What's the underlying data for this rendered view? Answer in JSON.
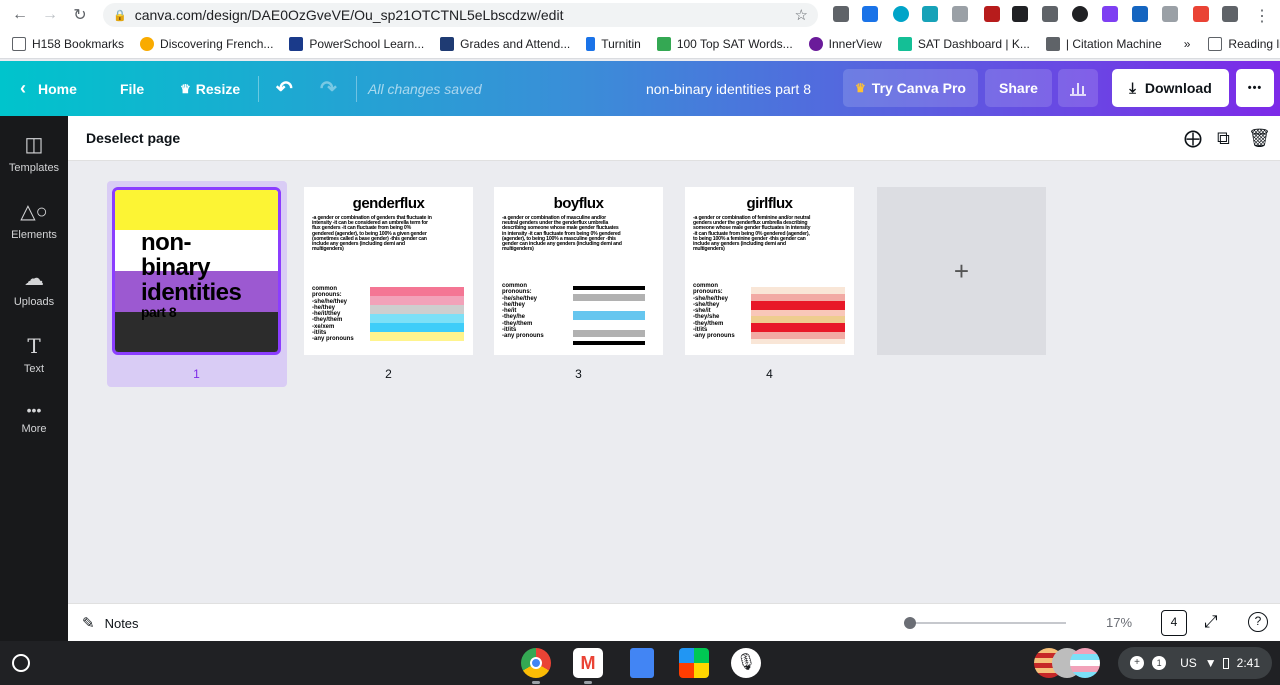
{
  "browser": {
    "url": "canva.com/design/DAE0OzGveVE/Ou_sp21OTCTNL5eLbscdzw/edit",
    "bookmarks": [
      {
        "label": "H158 Bookmarks",
        "color": "#5f6368"
      },
      {
        "label": "Discovering French...",
        "color": "#f9ab00"
      },
      {
        "label": "PowerSchool Learn...",
        "color": "#1a3a8a"
      },
      {
        "label": "Grades and Attend...",
        "color": "#1f3b73"
      },
      {
        "label": "Turnitin",
        "color": "#1a73e8"
      },
      {
        "label": "100 Top SAT Words...",
        "color": "#34a853"
      },
      {
        "label": "InnerView",
        "color": "#6a1b9a"
      },
      {
        "label": "SAT Dashboard | K...",
        "color": "#14bf96"
      },
      {
        "label": "| Citation Machine",
        "color": "#5f6368"
      }
    ],
    "more_bookmarks": "»",
    "reading_list": "Reading list"
  },
  "topbar": {
    "home": "Home",
    "file": "File",
    "resize": "Resize",
    "saved": "All changes saved",
    "design_title": "non-binary identities part 8",
    "try_pro": "Try Canva Pro",
    "share": "Share",
    "download": "Download",
    "more": "•••"
  },
  "sidebar": {
    "items": [
      {
        "label": "Templates"
      },
      {
        "label": "Elements"
      },
      {
        "label": "Uploads"
      },
      {
        "label": "Text"
      },
      {
        "label": "More"
      }
    ]
  },
  "header": {
    "deselect": "Deselect page"
  },
  "pages": [
    {
      "number": "1",
      "title_lines": [
        "non-",
        "binary",
        "identities"
      ],
      "subtitle": "part 8",
      "flag": [
        "#fcf434",
        "#ffffff",
        "#9c59d1",
        "#2c2c2c"
      ]
    },
    {
      "number": "2",
      "title": "genderflux",
      "desc": "-a gender or combination of genders that fluctuate in intensity -it can be considered an umbrella term for flux genders -it can fluctuate from being 0% gendered (agender), to being 100% a given gender (sometimes called a base gender) -this gender can include any genders (including demi and multigenders)",
      "pronouns": [
        "common",
        "pronouns:",
        "-she/he/they",
        "-he/they",
        "-he/it/they",
        "-they/them",
        "-xe/xem",
        "-it/its",
        "-any pronouns"
      ],
      "flag": [
        "#f47694",
        "#f2a2b9",
        "#cecece",
        "#7ce0f7",
        "#3ecdf9",
        "#fff48d"
      ]
    },
    {
      "number": "3",
      "title": "boyflux",
      "desc": "-a gender or combination of masculine and/or neutral genders under the genderflux umbrella describing someone whose male gender fluctuates in intensity -it can fluctuate from being 0% gendered (agender), to being 100% a masculine gender -this gender can include any genders (including demi and multigenders)",
      "pronouns": [
        "common",
        "pronouns:",
        "-he/she/they",
        "-he/they",
        "-he/it",
        "-they/he",
        "-they/them",
        "-it/its",
        "-any pronouns"
      ],
      "flag": [
        "#000000",
        "#ffffff",
        "#b1b1b1",
        "#ffffff",
        "#66c6ef",
        "#ffffff",
        "#b1b1b1",
        "#ffffff",
        "#000000"
      ]
    },
    {
      "number": "4",
      "title": "girlflux",
      "desc": "-a gender or combination of feminine and/or neutral genders under the genderflux umbrella describing someone whose male gender fluctuates in intensity -it can fluctuate from being 0% gendered (agender), to being 100% a feminine gender -this gender can include any genders (including demi and multigenders)",
      "pronouns": [
        "common",
        "pronouns:",
        "-she/he/they",
        "-she/they",
        "-she/it",
        "-they/she",
        "-they/them",
        "-it/its",
        "-any pronouns"
      ],
      "flag": [
        "#f9e6d7",
        "#f2aaa4",
        "#e81828",
        "#f9c7b9",
        "#eecd8f",
        "#e81828",
        "#f2aaa4",
        "#f9e6d7"
      ]
    }
  ],
  "add_page": "+",
  "bottom": {
    "notes": "Notes",
    "zoom": "17%",
    "page_count": "4",
    "help": "?"
  },
  "shelf": {
    "locale": "US",
    "time": "2:41",
    "notif_count": "1"
  }
}
